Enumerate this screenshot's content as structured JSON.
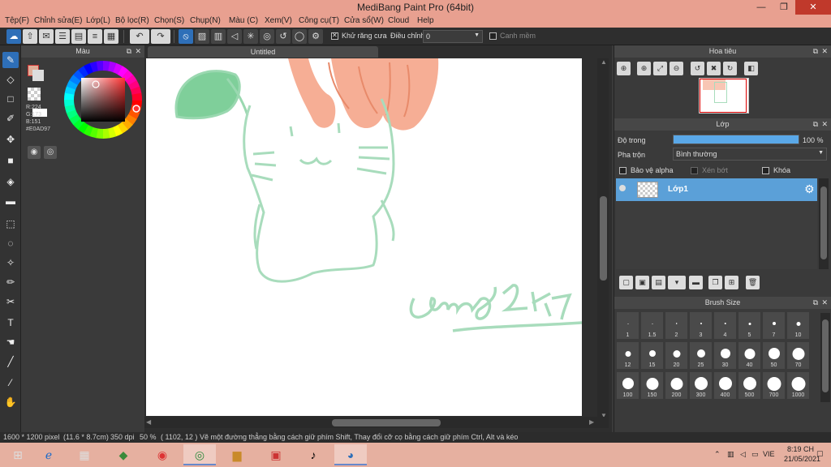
{
  "window": {
    "title": "MediBang Paint Pro (64bit)",
    "minimize": "—",
    "maximize": "❐",
    "close": "✕"
  },
  "menu": [
    "Tệp(F)",
    "Chỉnh sửa(E)",
    "Lớp(L)",
    "Bộ lọc(R)",
    "Chọn(S)",
    "Chụp(N)",
    "Màu (C)",
    "Xem(V)",
    "Công cụ(T)",
    "Cửa sổ(W)",
    "Cloud",
    "Help"
  ],
  "toolbar": {
    "antialias_label": "Khử răng cưa",
    "adjust_label": "Điều chỉnh",
    "adjust_value": "0",
    "snap_label": "Canh mềm"
  },
  "color_panel": {
    "title": "Màu",
    "r": "R:224",
    "g": "G:173",
    "b": "B:151",
    "hex": "#E0AD97",
    "primary_color": "#E0AD97",
    "hue_color": "#ff3333"
  },
  "canvas": {
    "tab_title": "Untitled",
    "signature": "Chung2k7"
  },
  "navigator": {
    "title": "Hoa tiêu"
  },
  "layer_panel": {
    "title": "Lớp",
    "opacity_label": "Độ trong",
    "opacity_value": "100 %",
    "opacity_fraction": 1.0,
    "blend_label": "Pha trộn",
    "blend_value": "Bình thường",
    "protect_alpha": "Bảo vệ alpha",
    "clipping": "Xén bớt",
    "lock": "Khóa",
    "layer_name": "Lớp1"
  },
  "brush_size": {
    "title": "Brush Size",
    "sizes": [
      "1",
      "1.5",
      "2",
      "3",
      "4",
      "5",
      "7",
      "10",
      "12",
      "15",
      "20",
      "25",
      "30",
      "40",
      "50",
      "70",
      "100",
      "150",
      "200",
      "300",
      "400",
      "500",
      "700",
      "1000"
    ]
  },
  "status": {
    "size": "1600 * 1200 pixel",
    "cm": "(11.6 * 8.7cm)",
    "dpi": "350 dpi",
    "zoom": "50 %",
    "coords": "( 1102, 12 )",
    "hint": "Vẽ một đường thẳng bằng cách giữ phím Shift, Thay đổi cỡ cọ bằng cách giữ phím Ctrl, Alt và kéo"
  },
  "taskbar": {
    "lang": "VIE",
    "time": "8:19 CH",
    "date": "21/05/2021"
  },
  "colors": {
    "accent": "#2e6fb8",
    "titlebar": "#e8a090",
    "stroke_green": "#a8dcbc",
    "leaf_green": "#7fcf9a",
    "orange": "#f4a082"
  }
}
